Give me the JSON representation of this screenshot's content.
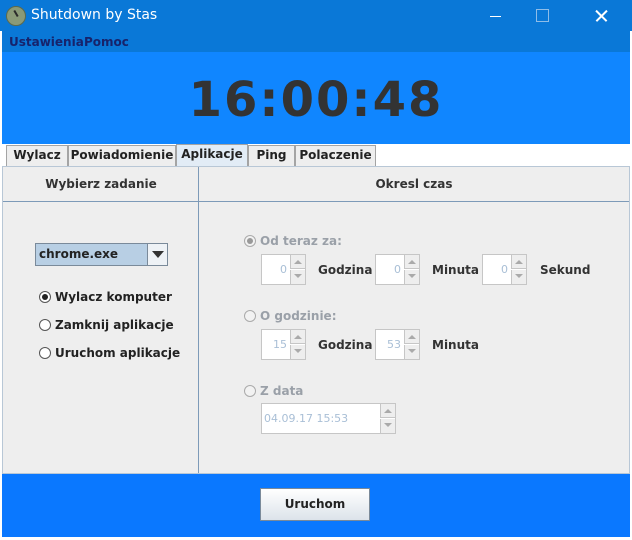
{
  "window": {
    "title": "Shutdown by Stas"
  },
  "menu": [
    "Ustawienia",
    "Pomoc"
  ],
  "clock": "16:00:48",
  "tabs": [
    "Wylacz",
    "Powiadomienie",
    "Aplikacje",
    "Ping",
    "Polaczenie"
  ],
  "active_tab": "Aplikacje",
  "left": {
    "header": "Wybierz zadanie",
    "combo_value": "chrome.exe",
    "options": [
      "Wylacz komputer",
      "Zamknij aplikacje",
      "Uruchom aplikacje"
    ],
    "selected": "Wylacz komputer"
  },
  "right": {
    "header": "Okresl czas",
    "from_now": {
      "label": "Od teraz za:",
      "hours": "0",
      "hours_unit": "Godzina",
      "minutes": "0",
      "minutes_unit": "Minuta",
      "seconds": "0",
      "seconds_unit": "Sekund"
    },
    "at_time": {
      "label": "O godzinie:",
      "hours": "15",
      "hours_unit": "Godzina",
      "minutes": "53",
      "minutes_unit": "Minuta"
    },
    "at_date": {
      "label": "Z data",
      "value": "04.09.17 15:53"
    }
  },
  "run_button": "Uruchom"
}
